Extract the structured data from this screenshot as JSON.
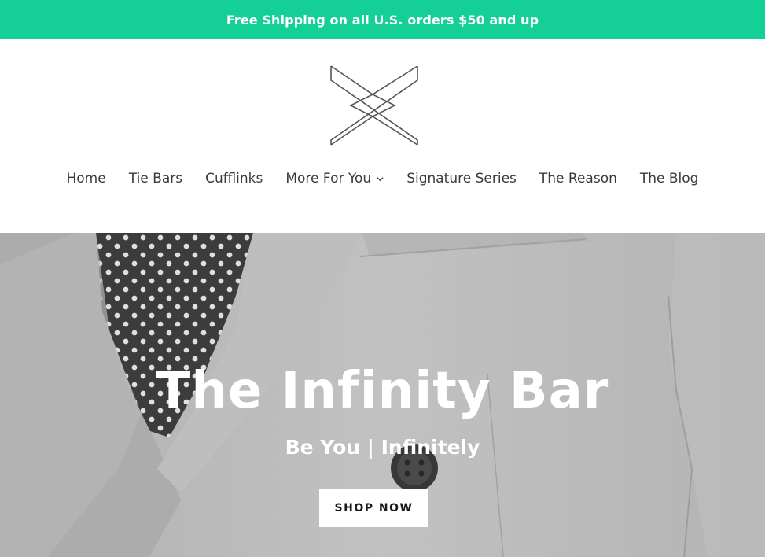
{
  "announcement": {
    "text": "Free Shipping on all U.S. orders $50 and up",
    "bg_color": "#14cf96"
  },
  "header": {
    "logo": {
      "icon": "infinity-x-logo"
    },
    "nav": [
      {
        "label": "Home"
      },
      {
        "label": "Tie Bars"
      },
      {
        "label": "Cufflinks"
      },
      {
        "label": "More For You",
        "has_dropdown": true
      },
      {
        "label": "Signature Series"
      },
      {
        "label": "The Reason"
      },
      {
        "label": "The Blog"
      }
    ]
  },
  "hero": {
    "title": "The Infinity Bar",
    "subtitle": "Be You | Infinitely",
    "cta_label": "SHOP NOW"
  }
}
